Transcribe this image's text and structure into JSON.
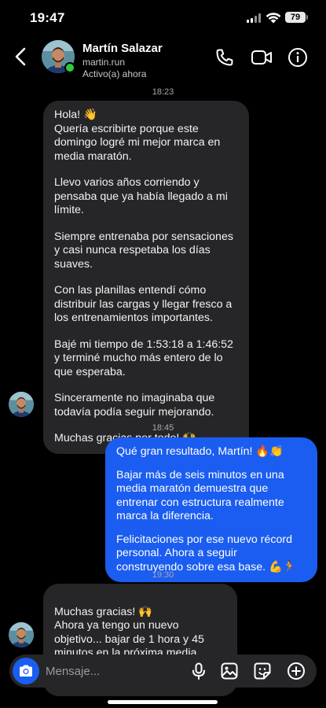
{
  "status_bar": {
    "time": "19:47",
    "battery": "79"
  },
  "header": {
    "name": "Martín Salazar",
    "username": "martin.run",
    "status": "Activo(a) ahora"
  },
  "messages": [
    {
      "timestamp": "18:23"
    },
    {
      "from": "contact",
      "paragraphs": [
        "Hola! 👋",
        "Quería escribirte porque este domingo logré mi mejor marca en media maratón.",
        "Llevo varios años corriendo y pensaba que ya había llegado a mi límite.",
        "Siempre entrenaba por sensaciones y casi nunca respetaba los días suaves.",
        "Con las planillas entendí cómo distribuir las cargas y llegar fresco a los entrenamientos importantes.",
        "Bajé mi tiempo de 1:53:18 a 1:46:52 y terminé mucho más entero de lo que esperaba.",
        "Sinceramente no imaginaba que todavía podía seguir mejorando.",
        "Muchas gracias por todo! 🙌"
      ]
    },
    {
      "timestamp": "18:45"
    },
    {
      "from": "me",
      "paragraphs": [
        "Qué gran resultado, Martín! 🔥👏",
        "Bajar más de seis minutos en una media maratón demuestra que entrenar con estructura realmente marca la diferencia.",
        "Felicitaciones por ese nuevo récord personal. Ahora a seguir construyendo sobre esa base. 💪🏃"
      ]
    },
    {
      "timestamp": "19:30"
    },
    {
      "from": "contact",
      "paragraphs": [
        "Muchas gracias! 🙌\nAhora ya tengo un nuevo objetivo... bajar de 1 hora y 45 minutos en la próxima media maratón. 😄🥇"
      ]
    }
  ],
  "composer": {
    "placeholder": "Mensaje..."
  },
  "colors": {
    "outgoing_bubble": "#1b5df0",
    "incoming_bubble": "#262628",
    "online": "#2ecc40"
  }
}
